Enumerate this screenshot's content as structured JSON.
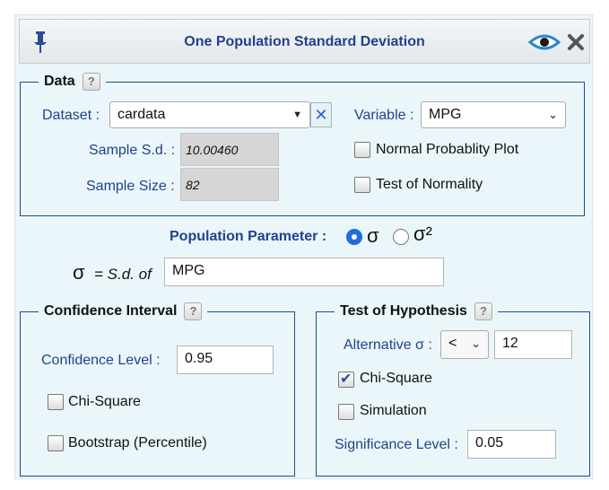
{
  "window": {
    "title": "One Population Standard Deviation",
    "pin_icon": "pin-icon",
    "eye_icon": "eye-icon",
    "close_icon": "close-icon"
  },
  "data_section": {
    "legend": "Data",
    "help": "?",
    "dataset_label": "Dataset :",
    "dataset_value": "cardata",
    "clear_symbol": "✕",
    "variable_label": "Variable :",
    "variable_value": "MPG",
    "sample_sd_label": "Sample S.d. :",
    "sample_sd_value": "10.00460",
    "sample_size_label": "Sample Size :",
    "sample_size_value": "82",
    "normal_plot_label": "Normal Probablity Plot",
    "normal_plot_checked": false,
    "normality_test_label": "Test of Normality",
    "normality_test_checked": false
  },
  "parameter": {
    "label": "Population Parameter :",
    "option_sigma": "σ",
    "option_sigma_sq": "σ²",
    "selected": "σ",
    "eq_symbol": "σ",
    "eq_text": "= S.d. of",
    "eq_value": "MPG"
  },
  "confidence": {
    "legend": "Confidence Interval",
    "help": "?",
    "level_label": "Confidence Level :",
    "level_value": "0.95",
    "chi_label": "Chi-Square",
    "chi_checked": false,
    "boot_label": "Bootstrap (Percentile)",
    "boot_checked": false
  },
  "hypothesis": {
    "legend": "Test of Hypothesis",
    "help": "?",
    "alt_label": "Alternative σ :",
    "alt_operator": "<",
    "alt_value": "12",
    "chi_label": "Chi-Square",
    "chi_checked": true,
    "sim_label": "Simulation",
    "sim_checked": false,
    "sig_label": "Significance Level :",
    "sig_value": "0.05"
  },
  "colors": {
    "title": "#24408e",
    "label": "#20448a",
    "border": "#1e4f86",
    "background": "#eaf6fa",
    "radio_selected": "#1e6fdc"
  }
}
